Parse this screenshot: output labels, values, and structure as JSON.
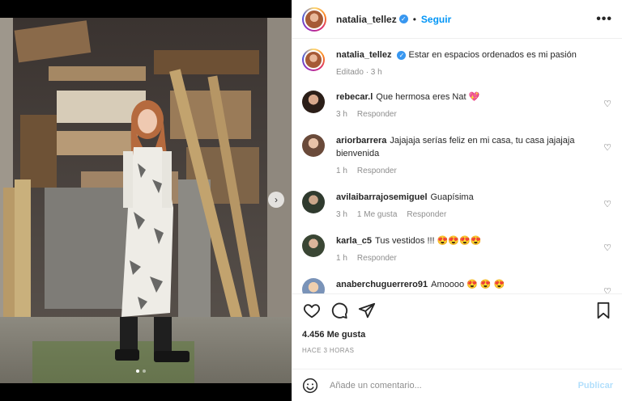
{
  "post": {
    "username": "natalia_tellez",
    "follow_label": "Seguir",
    "separator": "•",
    "more_label": "•••",
    "caption": "Estar en espacios ordenados es mi pasión",
    "caption_meta": "Editado · 3 h",
    "likes": "4.456 Me gusta",
    "time_ago": "HACE 3 HORAS"
  },
  "comments": [
    {
      "user": "rebecar.l",
      "text": "Que hermosa eres Nat",
      "emoji": "💖",
      "time": "3 h",
      "likes": "",
      "reply": "Responder"
    },
    {
      "user": "ariorbarrera",
      "text": "Jajajaja serías feliz en mi casa, tu casa jajajaja bienvenida",
      "emoji": "",
      "time": "1 h",
      "likes": "",
      "reply": "Responder"
    },
    {
      "user": "avilaibarrajosemiguel",
      "text": "Guapísima",
      "emoji": "",
      "time": "3 h",
      "likes": "1 Me gusta",
      "reply": "Responder"
    },
    {
      "user": "karla_c5",
      "text": "Tus vestidos !!!",
      "emoji": "😍😍😍😍",
      "time": "1 h",
      "likes": "",
      "reply": "Responder"
    },
    {
      "user": "anaberchuguerrero91",
      "text": "Amoooo",
      "emoji": "😍 😍 😍",
      "time": "",
      "likes": "",
      "reply": ""
    }
  ],
  "composer": {
    "placeholder": "Añade un comentario...",
    "publish_label": "Publicar"
  },
  "icons": {
    "like": "heart-icon",
    "comment": "comment-icon",
    "share": "paper-plane-icon",
    "save": "bookmark-icon",
    "emoji": "smiley-icon",
    "verified": "verified-badge-icon"
  },
  "colors": {
    "link_blue": "#0095f6",
    "publish_disabled": "#b2dffc",
    "verified_blue": "#3897f0"
  }
}
